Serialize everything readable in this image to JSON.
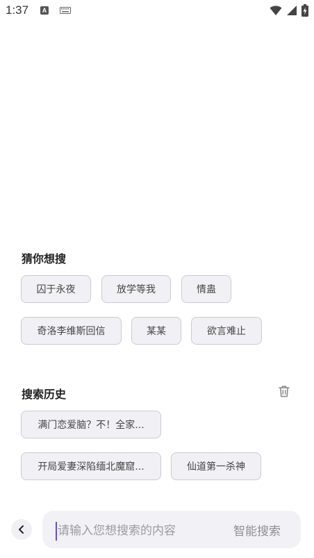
{
  "status_bar": {
    "time": "1:37",
    "notification_letter": "A"
  },
  "suggestions": {
    "title": "猜你想搜",
    "items": [
      "囚于永夜",
      "放学等我",
      "情蛊",
      "奇洛李维斯回信",
      "某某",
      "欲言难止"
    ]
  },
  "history": {
    "title": "搜索历史",
    "items": [
      "满门恋爱脑？不！全家...",
      "开局爱妻深陷缅北魔窟...",
      "仙道第一杀神"
    ]
  },
  "search": {
    "placeholder": "请输入您想搜索的内容",
    "value": "",
    "button_label": "智能搜索"
  },
  "icons": [
    "wifi-icon",
    "signal-icon",
    "battery-icon",
    "keyboard-icon",
    "trash-icon",
    "back-arrow-icon"
  ],
  "colors": {
    "accent_caret": "#6b4bd8",
    "chip_bg": "#f1f1f5",
    "chip_border": "#c9c9d2"
  }
}
